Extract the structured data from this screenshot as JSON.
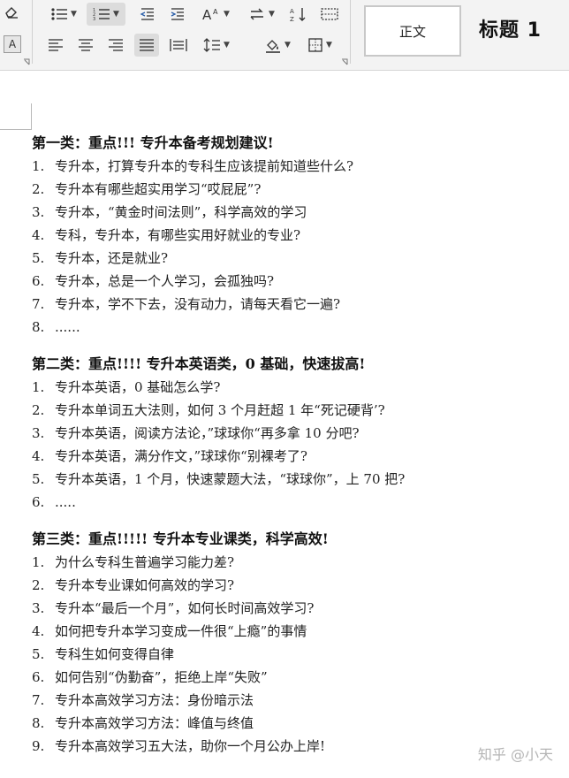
{
  "ribbon": {
    "char_shading_label": "A",
    "styles": {
      "normal": "正文",
      "heading1": "标题 1"
    }
  },
  "document": {
    "sections": [
      {
        "title": "第一类：重点!!! 专升本备考规划建议!",
        "items": [
          {
            "num": "1.",
            "text": "专升本，打算专升本的专科生应该提前知道些什么?"
          },
          {
            "num": "2.",
            "text": "专升本有哪些超实用学习“哎屁屁”?"
          },
          {
            "num": "3.",
            "text": "专升本，“黄金时间法则”，科学高效的学习"
          },
          {
            "num": "4.",
            "text": "专科，专升本，有哪些实用好就业的专业?"
          },
          {
            "num": "5.",
            "text": "专升本，还是就业?"
          },
          {
            "num": "6.",
            "text": "专升本，总是一个人学习，会孤独吗?"
          },
          {
            "num": "7.",
            "text": "专升本，学不下去，没有动力，请每天看它一遍?"
          },
          {
            "num": "8.",
            "text": "......"
          }
        ]
      },
      {
        "title": "第二类：重点!!!! 专升本英语类，0 基础，快速拔高!",
        "items": [
          {
            "num": "1.",
            "text": "专升本英语，0 基础怎么学?"
          },
          {
            "num": "2.",
            "text": "专升本单词五大法则，如何 3 个月赶超 1 年“死记硬背’?"
          },
          {
            "num": "3.",
            "text": "专升本英语，阅读方法论，”球球你“再多拿 10 分吧?"
          },
          {
            "num": "4.",
            "text": "专升本英语，满分作文，”球球你“别裸考了?"
          },
          {
            "num": "5.",
            "text": "专升本英语，1 个月，快速蒙题大法，“球球你”，上 70 把?"
          },
          {
            "num": "6.",
            "text": "....."
          }
        ]
      },
      {
        "title": "第三类：重点!!!!! 专升本专业课类，科学高效!",
        "items": [
          {
            "num": "1.",
            "text": "为什么专科生普遍学习能力差?"
          },
          {
            "num": "2.",
            "text": "专升本专业课如何高效的学习?"
          },
          {
            "num": "3.",
            "text": "专升本“最后一个月”，如何长时间高效学习?"
          },
          {
            "num": "4.",
            "text": "如何把专升本学习变成一件很“上瘾”的事情"
          },
          {
            "num": "5.",
            "text": "专科生如何变得自律"
          },
          {
            "num": "6.",
            "text": "如何告别“伪勤奋”，拒绝上岸“失败”"
          },
          {
            "num": "7.",
            "text": "专升本高效学习方法：身份暗示法"
          },
          {
            "num": "8.",
            "text": "专升本高效学习方法：峰值与终值"
          },
          {
            "num": "9.",
            "text": "专升本高效学习五大法，助你一个月公办上岸!"
          }
        ]
      }
    ]
  },
  "watermark": "知乎 @小天"
}
